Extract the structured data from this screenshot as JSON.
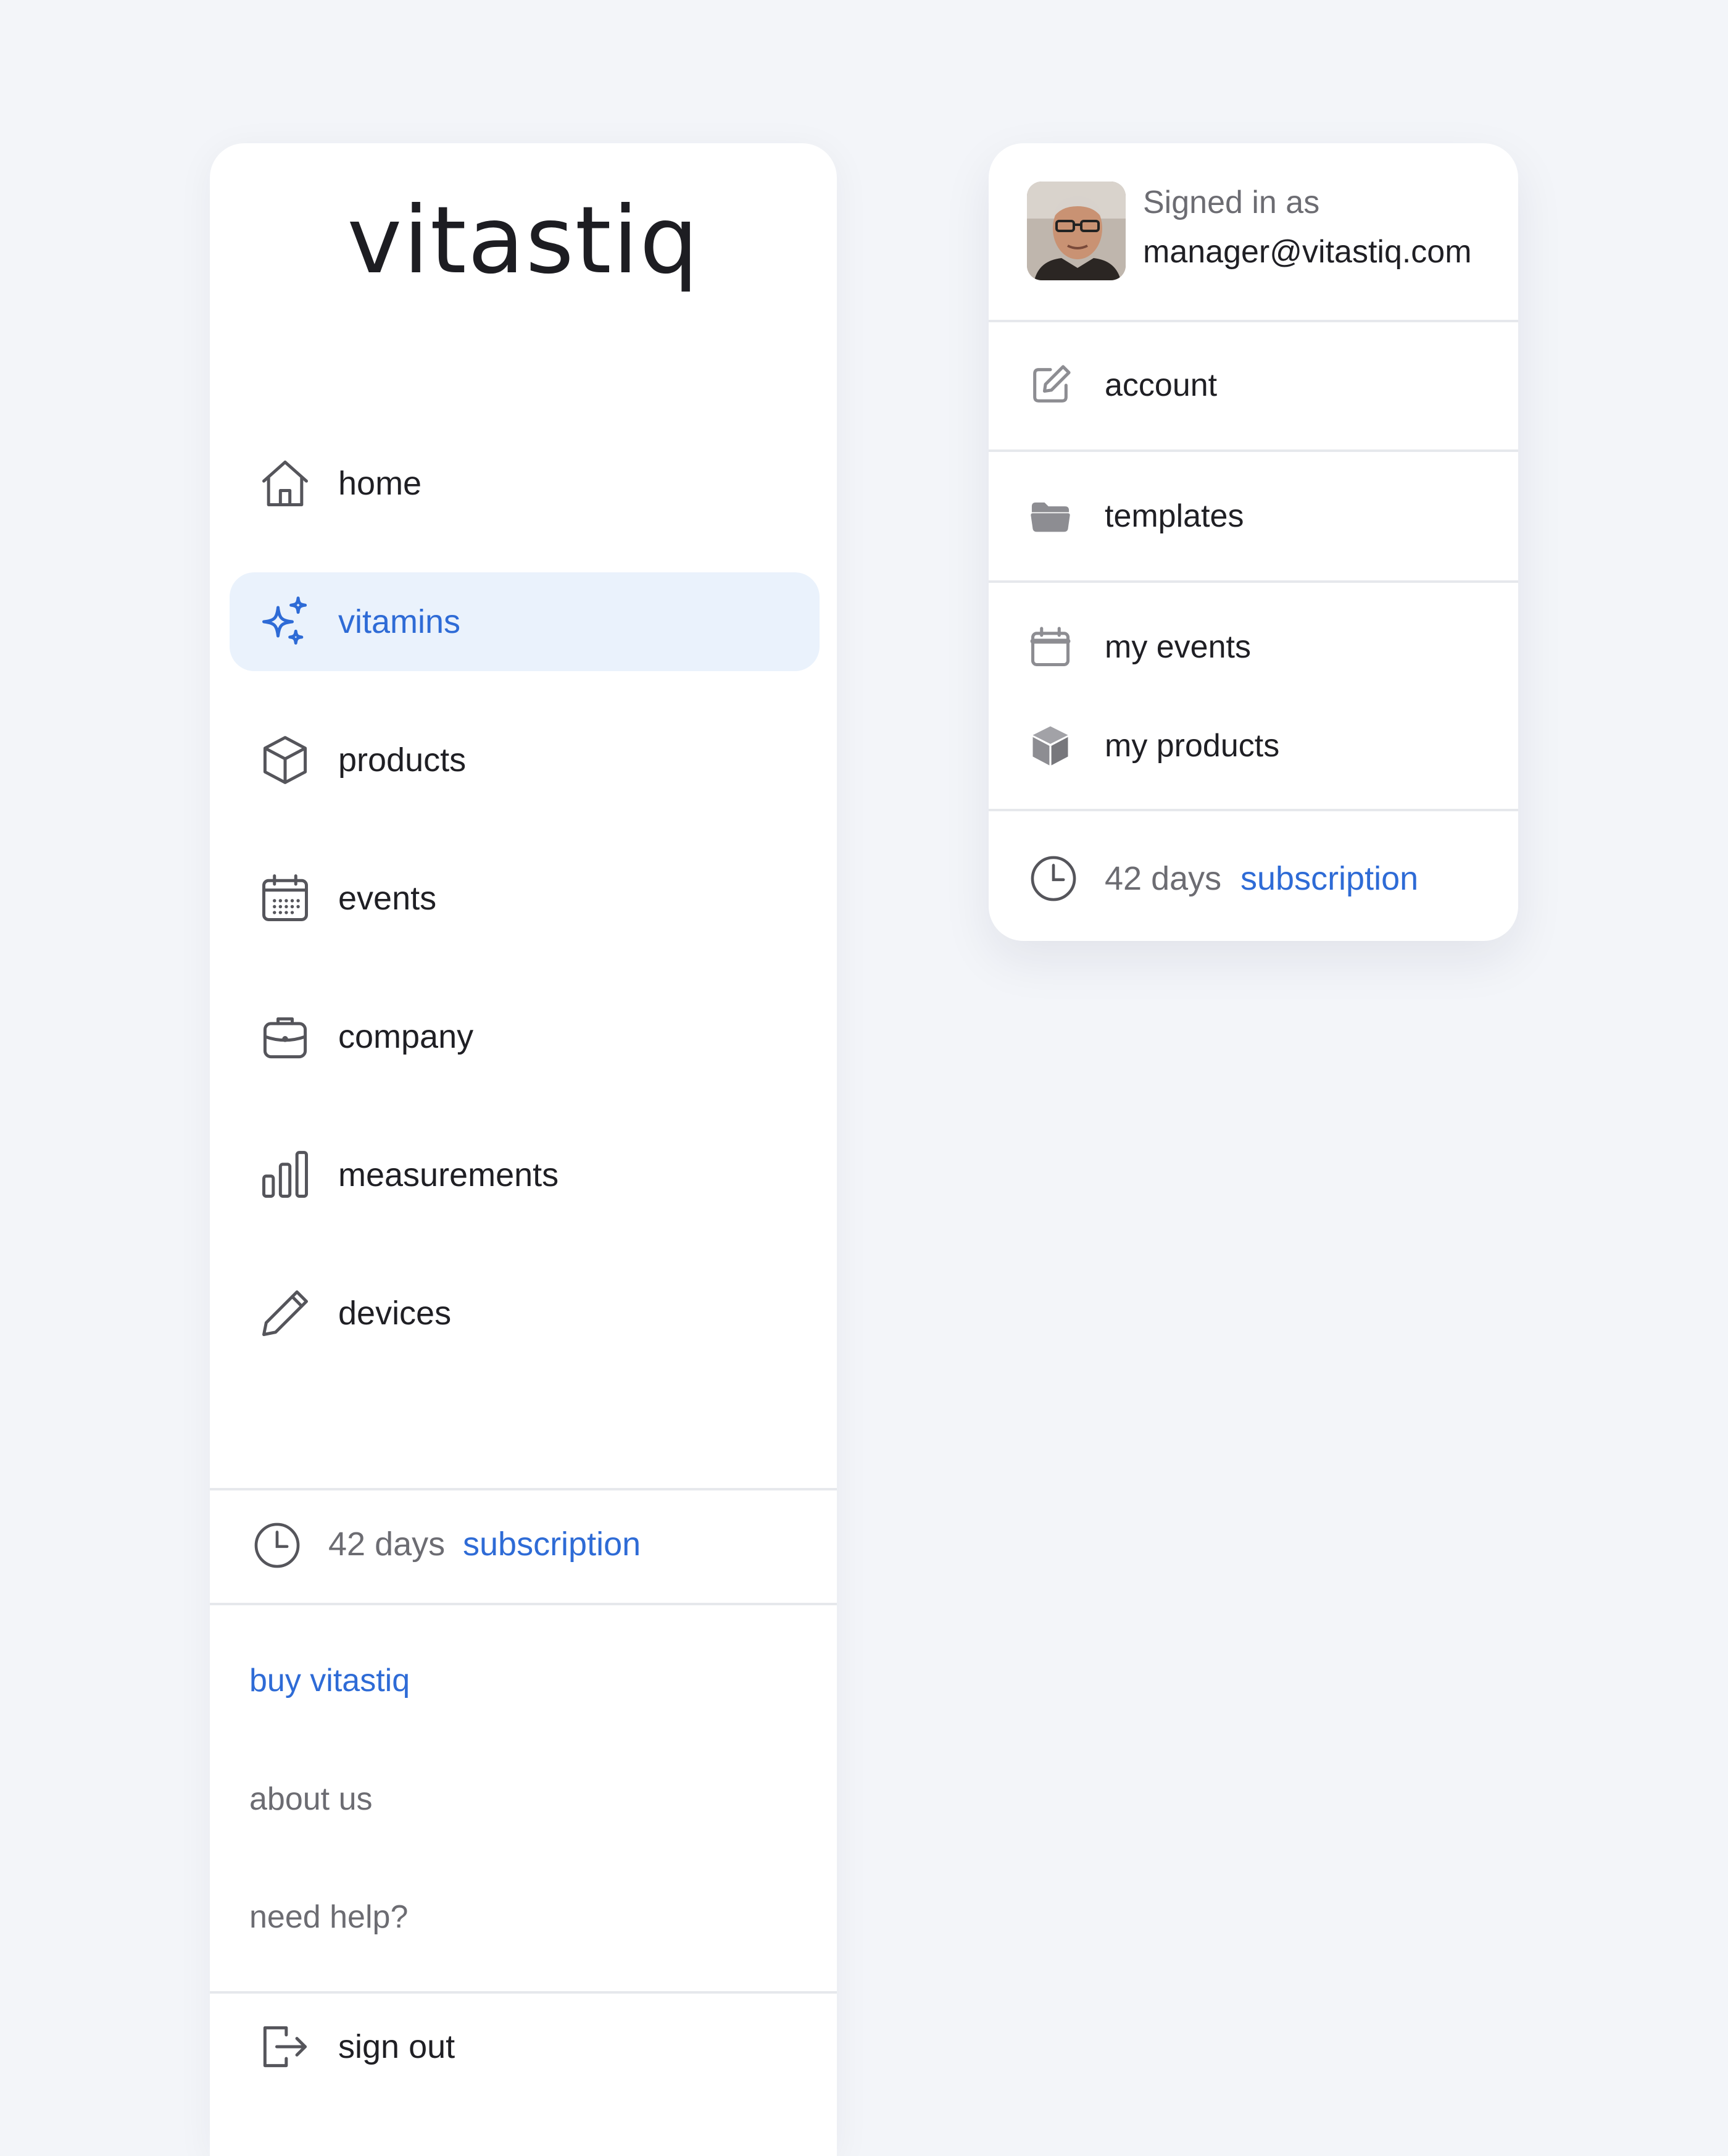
{
  "sidebar": {
    "logo": "vitastiq",
    "nav": [
      {
        "label": "home",
        "icon": "home-icon"
      },
      {
        "label": "vitamins",
        "icon": "sparkles-icon",
        "active": true
      },
      {
        "label": "products",
        "icon": "box-icon"
      },
      {
        "label": "events",
        "icon": "calendar-icon"
      },
      {
        "label": "company",
        "icon": "briefcase-icon"
      },
      {
        "label": "measurements",
        "icon": "bar-chart-icon"
      },
      {
        "label": "devices",
        "icon": "pencil-icon"
      }
    ],
    "subscription": {
      "days": "42 days",
      "link": "subscription",
      "icon": "clock-icon"
    },
    "links": {
      "buy": "buy vitastiq",
      "about": "about us",
      "help": "need help?"
    },
    "sign_out": {
      "label": "sign out",
      "icon": "sign-out-icon"
    }
  },
  "account_menu": {
    "signed_in_label": "Signed in as",
    "email": "manager@vitastiq.com",
    "items": [
      {
        "label": "account",
        "icon": "edit-icon"
      },
      {
        "label": "templates",
        "icon": "folder-icon"
      },
      {
        "label": "my events",
        "icon": "calendar-icon"
      },
      {
        "label": "my products",
        "icon": "cube-icon"
      }
    ],
    "subscription": {
      "days": "42 days",
      "link": "subscription",
      "icon": "clock-icon"
    }
  },
  "colors": {
    "accent": "#2e6bd6",
    "active_bg": "#eaf2fc",
    "page_bg": "#f3f5f9",
    "text": "#1f1f24",
    "muted": "#6c6c72"
  }
}
